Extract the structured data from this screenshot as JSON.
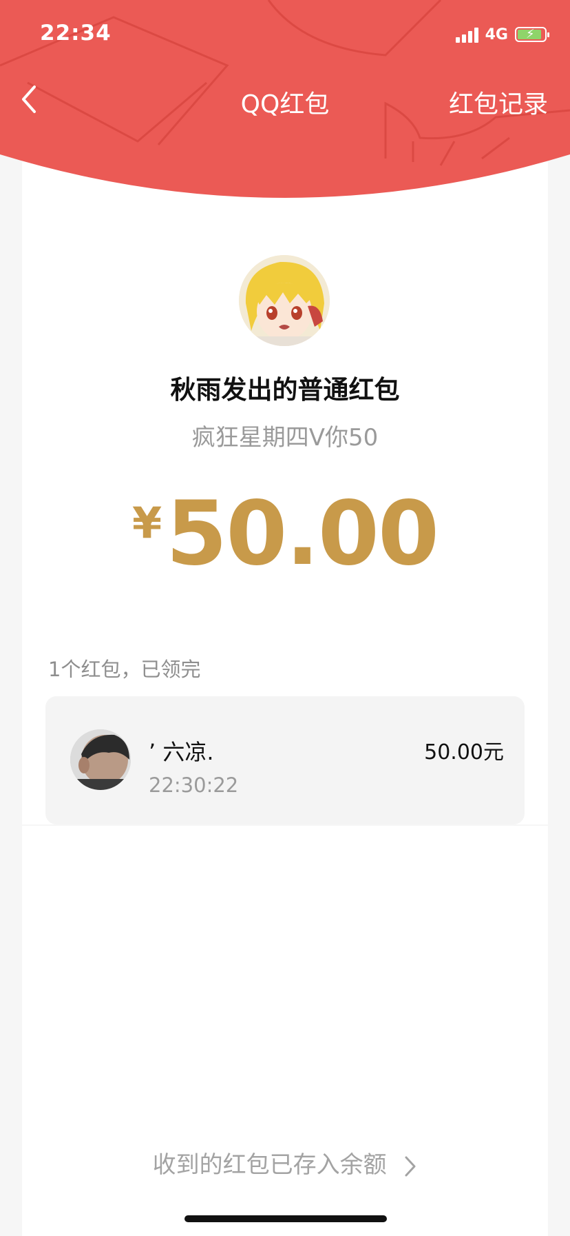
{
  "status_bar": {
    "time": "22:34",
    "network": "4G"
  },
  "nav": {
    "title": "QQ红包",
    "right_action": "红包记录"
  },
  "sender": {
    "title": "秋雨发出的普通红包",
    "message": "疯狂星期四V你50"
  },
  "amount": {
    "currency": "¥",
    "value": "50.00"
  },
  "summary": "1个红包，已领完",
  "receivers": [
    {
      "name": "’ 六凉.",
      "time": "22:30:22",
      "amount": "50.00元"
    }
  ],
  "footer_link": "收到的红包已存入余额",
  "colors": {
    "header_red": "#eb5a55",
    "amount_gold": "#c89a4a",
    "battery_green": "#8fd46a"
  }
}
